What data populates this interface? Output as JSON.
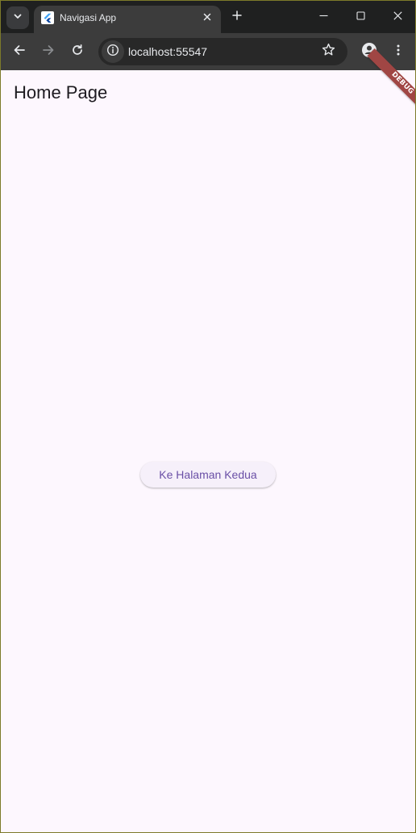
{
  "browser": {
    "tab": {
      "title": "Navigasi App"
    },
    "address_bar": {
      "url": "localhost:55547"
    }
  },
  "page": {
    "title": "Home Page",
    "button_label": "Ke Halaman Kedua",
    "debug_banner": "DEBUG"
  },
  "icons": {
    "tab_search": "chevron-down-icon",
    "favicon": "flutter-icon",
    "tab_close": "close-icon",
    "new_tab": "plus-icon",
    "minimize": "minimize-icon",
    "maximize": "maximize-icon",
    "close_window": "close-icon",
    "back": "arrow-left-icon",
    "forward": "arrow-right-icon",
    "reload": "reload-icon",
    "site_info": "info-icon",
    "bookmark": "star-icon",
    "profile": "profile-icon",
    "menu": "more-vertical-icon"
  },
  "colors": {
    "page_background": "#fdf7fe",
    "button_text": "#6a4fa6",
    "button_background": "#f6f0fa",
    "debug_banner": "#a04644",
    "browser_frame": "#1f2020",
    "toolbar": "#3c3c3c"
  }
}
